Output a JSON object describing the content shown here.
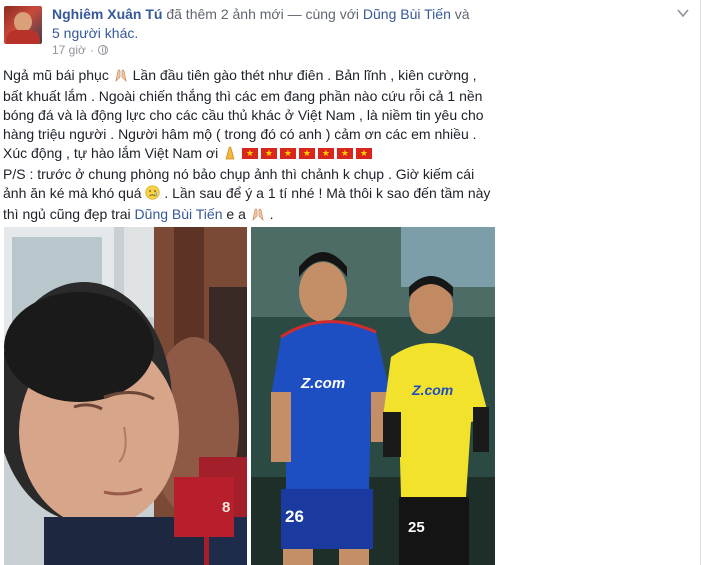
{
  "post": {
    "author": "Nghiêm Xuân Tú",
    "action_text": "đã thêm 2 ảnh mới — cùng với",
    "tagged_friend": "Dũng Bùi Tiến",
    "and_text": "và",
    "others_link": "5 người khác.",
    "time": "17 giờ",
    "privacy_icon": "globe-icon",
    "body": {
      "line1": "Ngả mũ bái phục",
      "line1b": "Lần đầu tiên gào thét như điên . Bản lĩnh , kiên cường ,",
      "line2": "bất khuất lắm . Ngoài chiến thắng thì các em đang phần nào cứu rỗi cả 1 nền",
      "line3": "bóng đá và là động lực cho các cầu thủ khác ở Việt Nam , là niềm tin yêu cho",
      "line4": "hàng triệu người . Người hâm mộ ( trong đó có anh ) cảm ơn các em nhiều .",
      "line5": "Xúc động , tự hào lắm Việt Nam ơi",
      "line6": "P/S : trước ở chung phòng nó bảo chụp ảnh thì chảnh k chụp . Giờ kiếm cái",
      "line7a": "ảnh ăn ké mà khó quá",
      "line7b": ". Lần sau để ý a 1 tí nhé ! Mà thôi k sao đến tầm này",
      "line8a": "thì ngủ cũng đẹp trai",
      "line8_link": "Dũng Bùi Tiến",
      "line8b": "e a",
      "line8c": "."
    },
    "photos": {
      "photo1_jersey": "8",
      "photo2_left_brand": "Z.com",
      "photo2_left_number": "26",
      "photo2_right_brand": "Z.com",
      "photo2_right_number": "25"
    }
  },
  "colors": {
    "link": "#365899",
    "text": "#1d2129",
    "meta": "#90949c",
    "flag_red": "#da251d",
    "flag_star": "#ffcd00",
    "jersey_blue": "#1e4fc2",
    "jersey_yellow": "#f2e22c"
  }
}
